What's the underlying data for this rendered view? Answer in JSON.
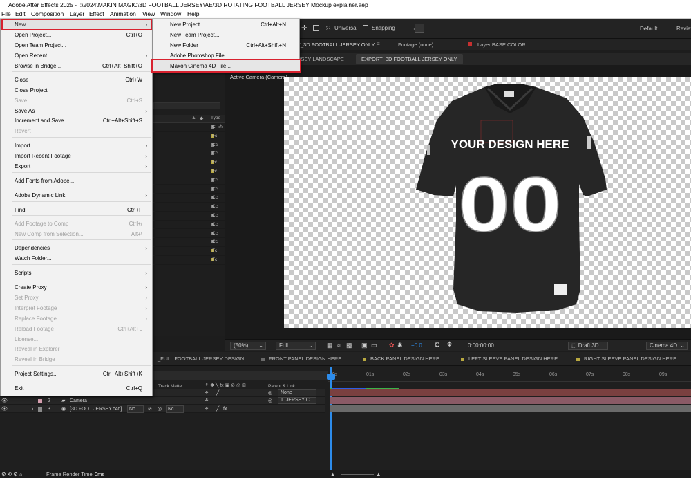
{
  "title": "Adobe After Effects 2025 - I:\\2024\\MAKIN MAGIC\\3D FOOTBALL JERSEY\\AE\\3D ROTATING FOOTBALL JERSEY Mockup explainer.aep",
  "app_logo": "Ae",
  "menubar": [
    "File",
    "Edit",
    "Composition",
    "Layer",
    "Effect",
    "Animation",
    "View",
    "Window",
    "Help"
  ],
  "toolbar": {
    "universal": "Universal",
    "snapping": "Snapping",
    "workspace_default": "Default",
    "workspace_review": "Review"
  },
  "file_menu": {
    "new": "New",
    "open_project": "Open Project...",
    "open_project_sc": "Ctrl+O",
    "open_team_project": "Open Team Project...",
    "open_recent": "Open Recent",
    "browse_bridge": "Browse in Bridge...",
    "browse_bridge_sc": "Ctrl+Alt+Shift+O",
    "close": "Close",
    "close_sc": "Ctrl+W",
    "close_project": "Close Project",
    "save": "Save",
    "save_sc": "Ctrl+S",
    "save_as": "Save As",
    "increment_save": "Increment and Save",
    "increment_save_sc": "Ctrl+Alt+Shift+S",
    "revert": "Revert",
    "import": "Import",
    "import_recent": "Import Recent Footage",
    "export": "Export",
    "add_fonts": "Add Fonts from Adobe...",
    "dynamic_link": "Adobe Dynamic Link",
    "find": "Find",
    "find_sc": "Ctrl+F",
    "add_footage": "Add Footage to Comp",
    "add_footage_sc": "Ctrl+/",
    "new_comp_sel": "New Comp from Selection...",
    "new_comp_sel_sc": "Alt+\\",
    "dependencies": "Dependencies",
    "watch_folder": "Watch Folder...",
    "scripts": "Scripts",
    "create_proxy": "Create Proxy",
    "set_proxy": "Set Proxy",
    "interpret": "Interpret Footage",
    "replace": "Replace Footage",
    "reload": "Reload Footage",
    "reload_sc": "Ctrl+Alt+L",
    "license": "License...",
    "reveal_explorer": "Reveal in Explorer",
    "reveal_bridge": "Reveal in Bridge",
    "project_settings": "Project Settings...",
    "project_settings_sc": "Ctrl+Alt+Shift+K",
    "exit": "Exit",
    "exit_sc": "Ctrl+Q"
  },
  "new_submenu": {
    "new_project": "New Project",
    "new_project_sc": "Ctrl+Alt+N",
    "new_team_project": "New Team Project...",
    "new_folder": "New Folder",
    "new_folder_sc": "Ctrl+Alt+Shift+N",
    "photoshop_file": "Adobe Photoshop File...",
    "cinema4d_file": "Maxon Cinema 4D File..."
  },
  "project_panel": {
    "type_header": "Type",
    "types": [
      "Cl",
      "Fc",
      "Cc",
      "Cc",
      "Fc",
      "Fc",
      "Cc",
      "Cc",
      "Cc",
      "Cc",
      "Cc",
      "Cc",
      "Cc",
      "Cc",
      "Fc",
      "Fc"
    ]
  },
  "comp_tabs": {
    "active": "RT_3D FOOTBALL JERSEY ONLY",
    "footage": "Footage (none)",
    "layer": "Layer BASE COLOR"
  },
  "view_tabs": {
    "tab1": "ERSEY LANDSCAPE",
    "tab2": "EXPORT_3D FOOTBALL JERSEY ONLY"
  },
  "viewer": {
    "camera_label": "Active Camera (Camera)",
    "jersey_text": "YOUR DESIGN HERE",
    "jersey_number": "00"
  },
  "viewer_bar": {
    "zoom": "(50%)",
    "quality": "Full",
    "exposure": "+0.0",
    "timecode": "0:00:00:00",
    "renderer": "Draft 3D",
    "renderer2": "Cinema 4D"
  },
  "timeline_tabs": [
    "_FULL FOOTBALL JERSEY DESIGN",
    "FRONT PANEL DESIGN HERE",
    "BACK PANEL DESIGN HERE",
    "LEFT SLEEVE PANEL DESIGN HERE",
    "RIGHT SLEEVE PANEL DESIGN HERE"
  ],
  "timeline": {
    "track_matte": "Track Matte",
    "parent_link": "Parent & Link",
    "ticks": [
      "00s",
      "01s",
      "02s",
      "03s",
      "04s",
      "05s",
      "06s",
      "07s",
      "08s",
      "09s"
    ],
    "layers": [
      {
        "num": "2",
        "name": "Camera",
        "parent": "1. JERSEY Cl"
      },
      {
        "num": "3",
        "name": "[3D FOO...JERSEY.c4d]",
        "matte": "Nc",
        "parent": "Nc"
      }
    ],
    "parent_none": "None"
  },
  "status": {
    "frame_render": "Frame Render Time:",
    "frame_render_value": "0ms"
  },
  "colors": {
    "highlight": "#d8222f",
    "menu_bg": "#f2f2f2",
    "accent_blue": "#2d8ceb"
  }
}
